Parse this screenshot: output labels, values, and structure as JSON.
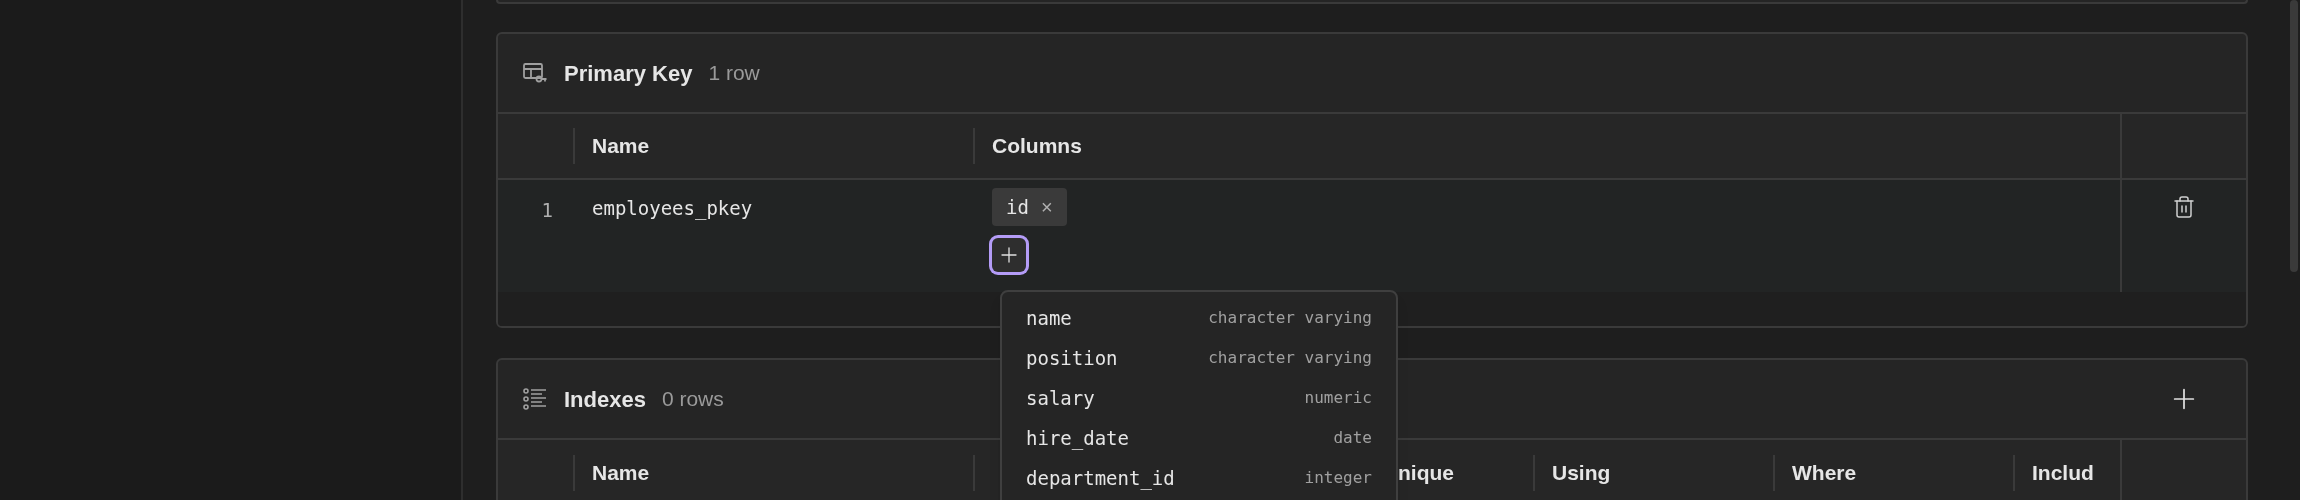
{
  "primary_key": {
    "title": "Primary Key",
    "count": "1 row",
    "columns": [
      "Name",
      "Columns"
    ],
    "rows": [
      {
        "index": "1",
        "name": "employees_pkey",
        "columns": [
          {
            "label": "id",
            "remove": "×"
          }
        ],
        "add_focused": true
      }
    ]
  },
  "column_picker": {
    "items": [
      {
        "name": "name",
        "type": "character varying"
      },
      {
        "name": "position",
        "type": "character varying"
      },
      {
        "name": "salary",
        "type": "numeric"
      },
      {
        "name": "hire_date",
        "type": "date"
      },
      {
        "name": "department_id",
        "type": "integer"
      }
    ]
  },
  "indexes": {
    "title": "Indexes",
    "count": "0 rows",
    "columns": [
      "Name",
      "nique",
      "Using",
      "Where",
      "Includ"
    ]
  }
}
